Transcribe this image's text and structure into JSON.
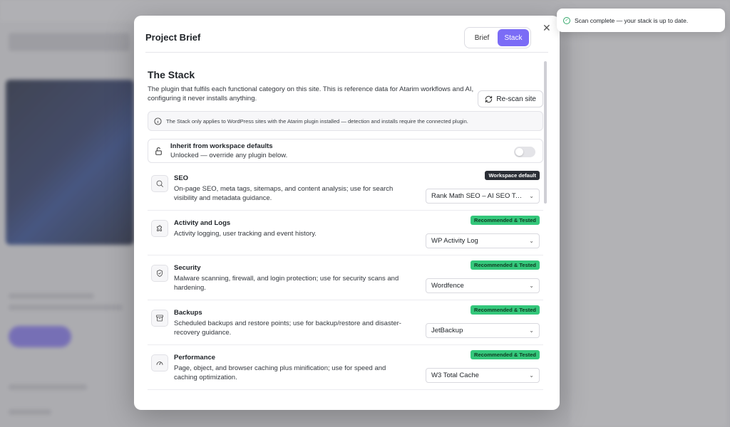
{
  "modal": {
    "title": "Project Brief",
    "tabs": [
      {
        "label": "Brief",
        "active": false
      },
      {
        "label": "Stack",
        "active": true
      }
    ],
    "close_icon": "close-icon"
  },
  "stack": {
    "title": "The Stack",
    "description": "The plugin that fulfils each functional category on this site. This is reference data for Atarim workflows and AI, configuring it never installs anything.",
    "rescan_label": "Re-scan site",
    "info_text": "The Stack only applies to WordPress sites with the Atarim plugin installed — detection and installs require the connected plugin.",
    "inherit": {
      "title": "Inherit from workspace defaults",
      "subtitle": "Unlocked — override any plugin below.",
      "enabled": false
    },
    "categories": [
      {
        "name": "SEO",
        "icon": "search-icon",
        "description": "On-page SEO, meta tags, sitemaps, and content analysis; use for search visibility and metadata guidance.",
        "badge": "Workspace default",
        "badge_type": "dark",
        "selected": "Rank Math SEO – AI SEO Tool…"
      },
      {
        "name": "Activity and Logs",
        "icon": "puzzle-icon",
        "description": "Activity logging, user tracking and event history.",
        "badge": "Recommended & Tested",
        "badge_type": "green",
        "selected": "WP Activity Log"
      },
      {
        "name": "Security",
        "icon": "shield-icon",
        "description": "Malware scanning, firewall, and login protection; use for security scans and hardening.",
        "badge": "Recommended & Tested",
        "badge_type": "green",
        "selected": "Wordfence"
      },
      {
        "name": "Backups",
        "icon": "archive-icon",
        "description": "Scheduled backups and restore points; use for backup/restore and disaster-recovery guidance.",
        "badge": "Recommended & Tested",
        "badge_type": "green",
        "selected": "JetBackup"
      },
      {
        "name": "Performance",
        "icon": "gauge-icon",
        "description": "Page, object, and browser caching plus minification; use for speed and caching optimization.",
        "badge": "Recommended & Tested",
        "badge_type": "green",
        "selected": "W3 Total Cache"
      }
    ]
  },
  "toast": {
    "message": "Scan complete — your stack is up to date.",
    "icon": "check-circle-icon"
  },
  "colors": {
    "accent": "#7b6cf6",
    "badge_green": "#34c77b",
    "badge_dark": "#2b2f36"
  }
}
